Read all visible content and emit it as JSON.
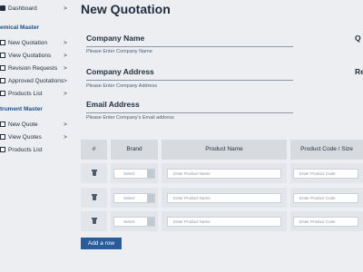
{
  "sidebar": {
    "dashboard": "Dashboard",
    "chemical_section": "emical Master",
    "chemical_items": [
      {
        "label": "New Quotation"
      },
      {
        "label": "View Quotations"
      },
      {
        "label": "Revision Requests"
      },
      {
        "label": "Approved Quotations"
      },
      {
        "label": "Products List"
      }
    ],
    "instrument_section": "trument Master",
    "instrument_items": [
      {
        "label": "New Quote"
      },
      {
        "label": "View Quotes"
      },
      {
        "label": "Products List"
      }
    ],
    "chevron": ">"
  },
  "page": {
    "title": "New Quotation"
  },
  "form": {
    "company_name": {
      "label": "Company Name",
      "placeholder": "Please Enter Company Name"
    },
    "company_address": {
      "label": "Company Address",
      "placeholder": "Please Enter Company Address"
    },
    "email_address": {
      "label": "Email Address",
      "placeholder": "Please Enter Company's Email address"
    },
    "right_col_label_1": "Q",
    "right_col_label_2": "Re"
  },
  "table": {
    "headers": [
      "#",
      "Brand",
      "Product Name",
      "Product Code / Size"
    ],
    "rows": [
      {
        "brand": "Select",
        "product_name": "Enter Product Name",
        "product_code": "Enter Product Code"
      },
      {
        "brand": "Select",
        "product_name": "Enter Product Name",
        "product_code": "Enter Product Code"
      },
      {
        "brand": "Select",
        "product_name": "Enter Product Name",
        "product_code": "Enter Product Code"
      }
    ]
  },
  "actions": {
    "add_row": "Add a row"
  },
  "colors": {
    "background": "#eceef1",
    "primary": "#2b5c9a",
    "section_heading": "#1f4e8c",
    "table_header": "#d7dadf"
  },
  "icons": {
    "dashboard": "dashboard-icon",
    "menu_item": "page-icon",
    "row_delete": "trash-icon"
  }
}
